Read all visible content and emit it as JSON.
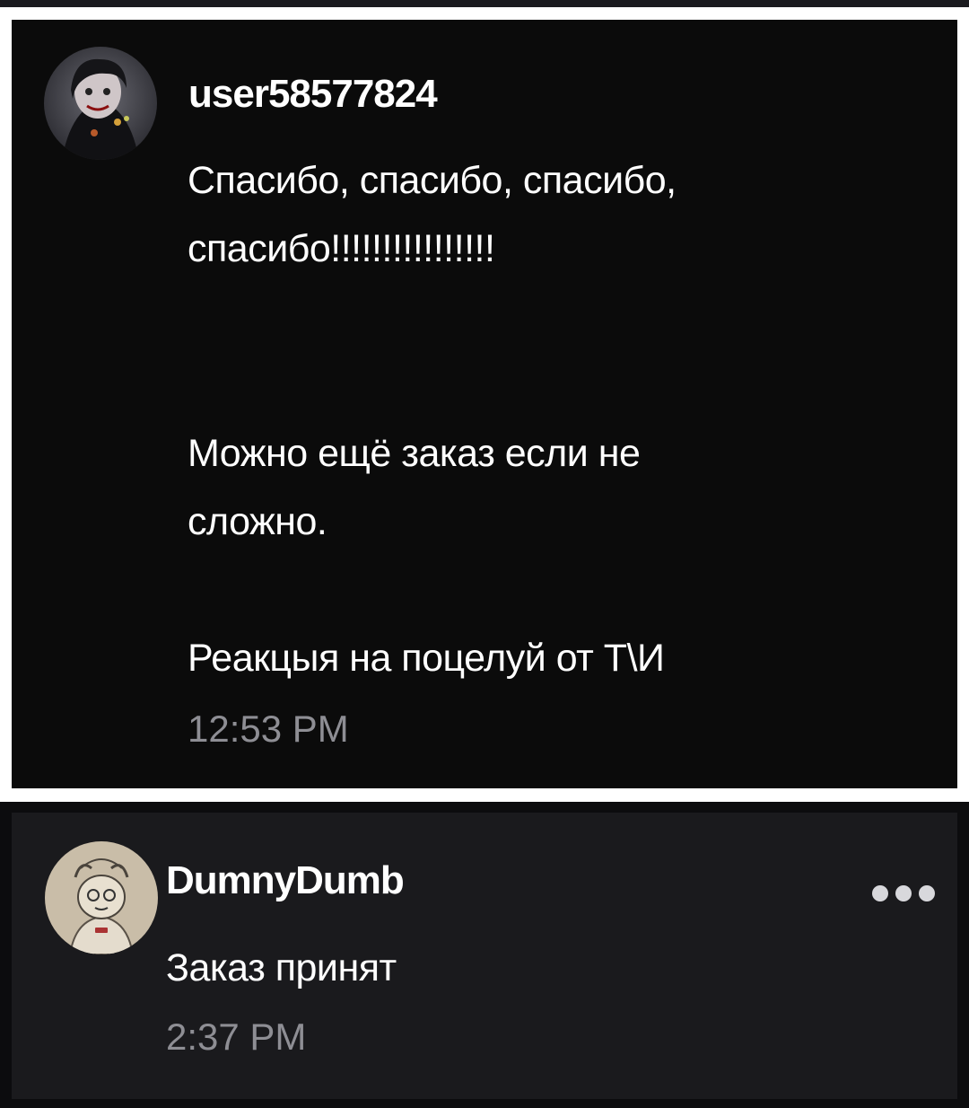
{
  "comments": [
    {
      "username": "user58577824",
      "message_lines": [
        "Спасибо, спасибо, спасибо,",
        "спасибо!!!!!!!!!!!!!!!!",
        "",
        "",
        "Можно ещё заказ если не",
        "сложно.",
        "",
        "Реакцыя на поцелуй от Т\\И"
      ],
      "time": "12:53 PM",
      "avatar_icon": "dark-anime-avatar"
    },
    {
      "username": "DumnyDumb",
      "message_lines": [
        "Заказ принят"
      ],
      "time": "2:37 PM",
      "avatar_icon": "sketch-character-avatar",
      "menu_icon": "more-options-icon"
    }
  ],
  "colors": {
    "card_dark": "#0b0b0b",
    "card_grey": "#1a1a1d",
    "text": "#ffffff",
    "muted": "#8e8e94"
  }
}
